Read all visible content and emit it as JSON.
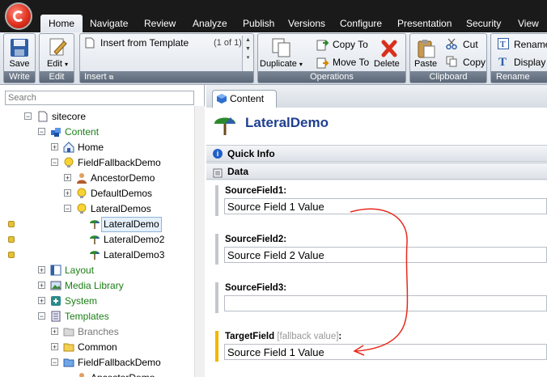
{
  "ribbon_tabs": [
    "Home",
    "Navigate",
    "Review",
    "Analyze",
    "Publish",
    "Versions",
    "Configure",
    "Presentation",
    "Security",
    "View"
  ],
  "ribbon": {
    "write": {
      "label": "Write",
      "save": "Save"
    },
    "edit": {
      "label": "Edit",
      "edit": "Edit"
    },
    "insert": {
      "label": "Insert",
      "item": "Insert from Template",
      "count": "(1 of 1)"
    },
    "operations": {
      "label": "Operations",
      "duplicate": "Duplicate",
      "copy_to": "Copy To",
      "move_to": "Move To",
      "delete": "Delete"
    },
    "clipboard": {
      "label": "Clipboard",
      "paste": "Paste",
      "cut": "Cut",
      "copy": "Copy"
    },
    "rename": {
      "label": "Rename",
      "rename": "Rename",
      "display_name": "Display N"
    }
  },
  "search": {
    "placeholder": "Search"
  },
  "tree": [
    "sitecore",
    "Content",
    "Home",
    "FieldFallbackDemo",
    "AncestorDemo",
    "DefaultDemos",
    "LateralDemos",
    "LateralDemo",
    "LateralDemo2",
    "LateralDemo3",
    "Layout",
    "Media Library",
    "System",
    "Templates",
    "Branches",
    "Common",
    "FieldFallbackDemo",
    "AncestorDemo"
  ],
  "content": {
    "tab_label": "Content",
    "item_title": "LateralDemo",
    "quick_info": "Quick Info",
    "data_section": "Data",
    "fields": [
      {
        "label": "SourceField1:",
        "value": "Source Field 1 Value"
      },
      {
        "label": "SourceField2:",
        "value": "Source Field 2 Value"
      },
      {
        "label": "SourceField3:",
        "value": ""
      },
      {
        "label": "TargetField",
        "hint": "[fallback value]",
        "suffix": ":",
        "value": "Source Field 1 Value"
      }
    ]
  },
  "colors": {
    "annotation_arrow": "#e8281c",
    "fallback_bar": "#f2b600",
    "tree_green": "#1b7e16"
  }
}
